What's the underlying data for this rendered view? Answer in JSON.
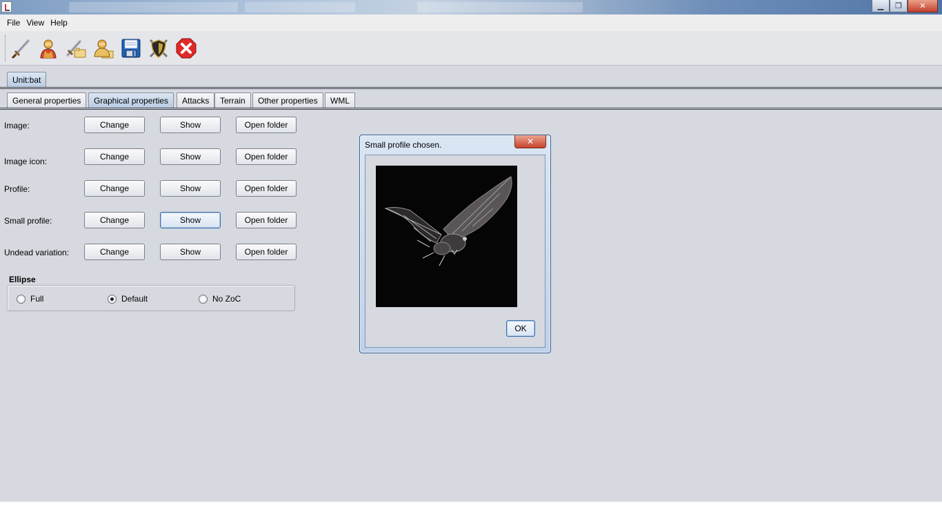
{
  "window": {
    "close_glyph": "✕",
    "minimize_glyph": "▁",
    "restore_glyph": "❐"
  },
  "menubar": {
    "items": [
      "File",
      "View",
      "Help"
    ]
  },
  "toolbar": {
    "tools": [
      {
        "name": "sword-icon"
      },
      {
        "name": "unit-icon"
      },
      {
        "name": "open-sword-icon"
      },
      {
        "name": "open-unit-icon"
      },
      {
        "name": "save-icon"
      },
      {
        "name": "shield-icon"
      },
      {
        "name": "exit-icon"
      }
    ]
  },
  "unit_tab": {
    "label": "Unit:bat"
  },
  "prop_tabs": [
    {
      "label": "General properties",
      "selected": false
    },
    {
      "label": "Graphical properties",
      "selected": true
    },
    {
      "label": "Attacks",
      "selected": false
    },
    {
      "label": "Terrain",
      "selected": false
    },
    {
      "label": "Other properties",
      "selected": false
    },
    {
      "label": "WML",
      "selected": false
    }
  ],
  "rows": [
    {
      "label": "Image:",
      "change": "Change",
      "show": "Show",
      "open": "Open folder"
    },
    {
      "label": "Image icon:",
      "change": "Change",
      "show": "Show",
      "open": "Open folder"
    },
    {
      "label": "Profile:",
      "change": "Change",
      "show": "Show",
      "open": "Open folder"
    },
    {
      "label": "Small profile:",
      "change": "Change",
      "show": "Show",
      "open": "Open folder"
    },
    {
      "label": "Undead variation:",
      "change": "Change",
      "show": "Show",
      "open": "Open folder"
    }
  ],
  "ellipse": {
    "title": "Ellipse",
    "options": [
      {
        "label": "Full",
        "selected": false
      },
      {
        "label": "Default",
        "selected": true
      },
      {
        "label": "No ZoC",
        "selected": false
      }
    ]
  },
  "dialog": {
    "title": "Small profile chosen.",
    "close_glyph": "✕",
    "ok_label": "OK"
  }
}
